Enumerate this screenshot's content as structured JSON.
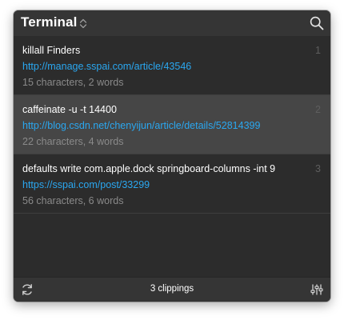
{
  "header": {
    "title": "Terminal"
  },
  "clippings": [
    {
      "command": "killall Finders",
      "url": "http://manage.sspai.com/article/43546",
      "meta": "15 characters, 2 words",
      "index": "1",
      "selected": false
    },
    {
      "command": "caffeinate -u -t 14400",
      "url": "http://blog.csdn.net/chenyijun/article/details/52814399",
      "meta": "22 characters, 4 words",
      "index": "2",
      "selected": true
    },
    {
      "command": "defaults write com.apple.dock springboard-columns -int 9",
      "url": "https://sspai.com/post/33299",
      "meta": "56 characters, 6 words",
      "index": "3",
      "selected": false
    }
  ],
  "footer": {
    "count_label": "3 clippings"
  },
  "icons": {
    "search": "search-icon",
    "updown": "chevron-updown-icon",
    "refresh": "refresh-icon",
    "settings": "sliders-icon"
  },
  "colors": {
    "background": "#2c2c2c",
    "selected_row": "#464646",
    "link": "#2aa7f0",
    "meta_text": "#8a8a8a"
  }
}
